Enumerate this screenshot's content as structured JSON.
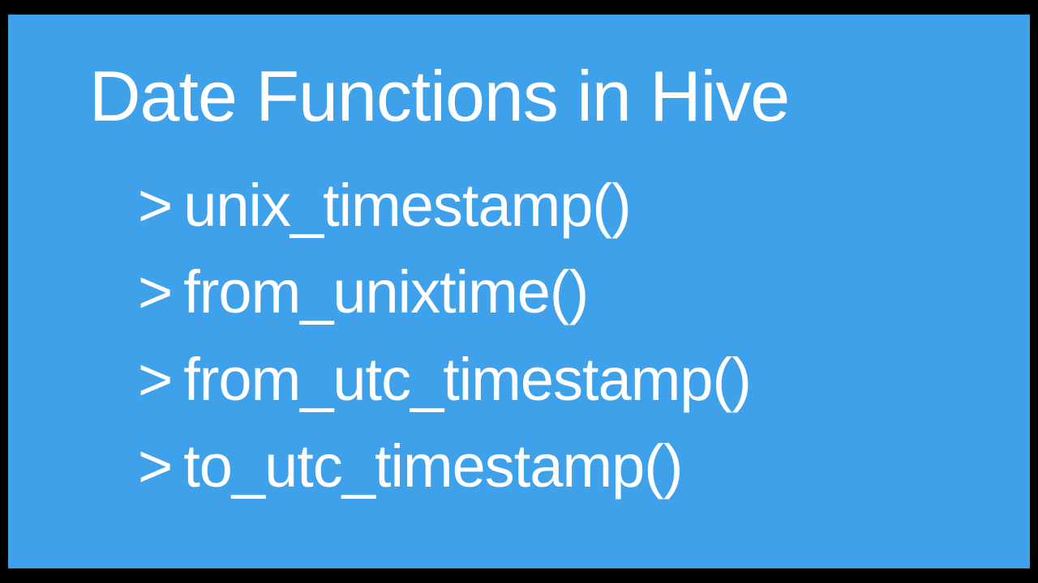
{
  "slide": {
    "title": "Date Functions in Hive",
    "bullets": [
      {
        "marker": ">",
        "text": "unix_timestamp()"
      },
      {
        "marker": ">",
        "text": "from_unixtime()"
      },
      {
        "marker": ">",
        "text": "from_utc_timestamp()"
      },
      {
        "marker": ">",
        "text": "to_utc_timestamp()"
      }
    ]
  }
}
